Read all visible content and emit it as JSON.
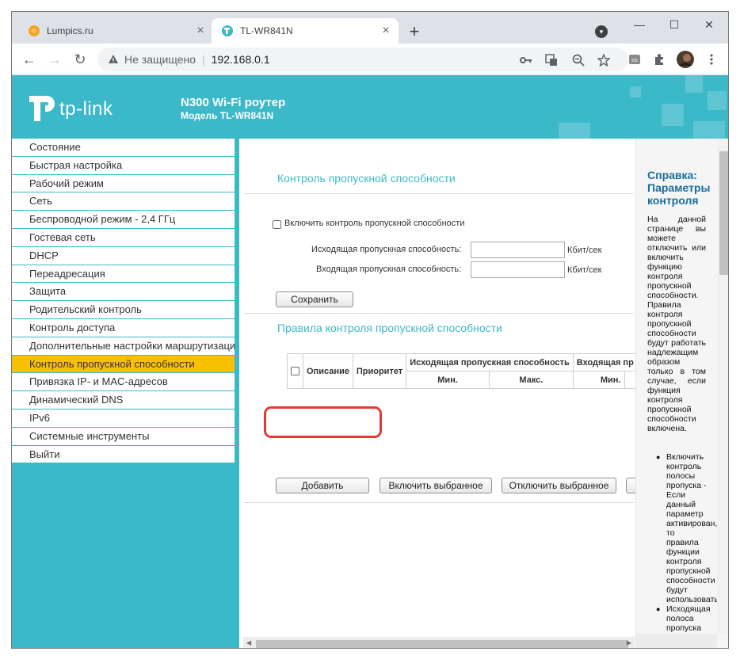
{
  "browser": {
    "tabs": [
      {
        "title": "Lumpics.ru",
        "favicon": "orange-circle-icon",
        "close": "×"
      },
      {
        "title": "TL-WR841N",
        "favicon": "tp-link-icon",
        "close": "×"
      }
    ],
    "new_tab": "+",
    "window_controls": {
      "minimize": "—",
      "maximize": "☐",
      "close": "✕"
    },
    "nav": {
      "back": "←",
      "forward": "→",
      "reload": "↻"
    },
    "address": {
      "security_label": "Не защищено",
      "separator": "|",
      "url": "192.168.0.1"
    },
    "omnibox_icons": [
      "key-icon",
      "translate-icon",
      "zoom-icon",
      "star-icon"
    ],
    "extension_icons": [
      "extension-os-icon",
      "puzzle-icon",
      "avatar",
      "menu-icon"
    ]
  },
  "router": {
    "brand": "tp-link",
    "title": "N300 Wi-Fi роутер",
    "model": "Модель TL-WR841N",
    "accent_color": "#3cb9c9",
    "menu": [
      {
        "label": "Состояние",
        "active": false
      },
      {
        "label": "Быстрая настройка",
        "active": false
      },
      {
        "label": "Рабочий режим",
        "active": false
      },
      {
        "label": "Сеть",
        "active": false
      },
      {
        "label": "Беспроводной режим - 2,4 ГГц",
        "active": false
      },
      {
        "label": "Гостевая сеть",
        "active": false
      },
      {
        "label": "DHCP",
        "active": false
      },
      {
        "label": "Переадресация",
        "active": false
      },
      {
        "label": "Защита",
        "active": false
      },
      {
        "label": "Родительский контроль",
        "active": false
      },
      {
        "label": "Контроль доступа",
        "active": false
      },
      {
        "label": "Дополнительные настройки маршрутизации",
        "active": false
      },
      {
        "label": "Контроль пропускной способности",
        "active": true
      },
      {
        "label": "Привязка IP- и MAC-адресов",
        "active": false
      },
      {
        "label": "Динамический DNS",
        "active": false
      },
      {
        "label": "IPv6",
        "active": false
      },
      {
        "label": "Системные инструменты",
        "active": false
      },
      {
        "label": "Выйти",
        "active": false
      }
    ],
    "content": {
      "heading": "Контроль пропускной способности",
      "enable_label": "Включить контроль пропускной способности",
      "enable_checked": false,
      "egress_label": "Исходящая пропускная способность:",
      "egress_value": "",
      "egress_unit": "Кбит/сек",
      "ingress_label": "Входящая пропускная способность:",
      "ingress_value": "",
      "ingress_unit": "Кбит/сек",
      "save_button": "Сохранить",
      "rules_heading": "Правила контроля пропускной способности",
      "table": {
        "col_description": "Описание",
        "col_priority": "Приоритет",
        "col_egress": "Исходящая пропускная способность",
        "col_ingress": "Входящая пр",
        "min": "Мин.",
        "max": "Макс."
      },
      "add_button": "Добавить",
      "enable_selected_button": "Включить выбранное",
      "disable_selected_button": "Отключить выбранное"
    },
    "help": {
      "title": "Справка: Параметры контроля",
      "body": "На данной странице вы можете отключить или включить функцию контроля пропускной способности. Правила контроля пропускной способности будут работать надлежащим образом только в том случае, если функция контроля пропускной способности включена.",
      "bullet1": "Включить контроль полосы пропуска - Если данный параметр активирован, то правила функции контроля пропускной способности будут использоваться.",
      "bullet2": "Исходящая полоса пропуска"
    }
  }
}
